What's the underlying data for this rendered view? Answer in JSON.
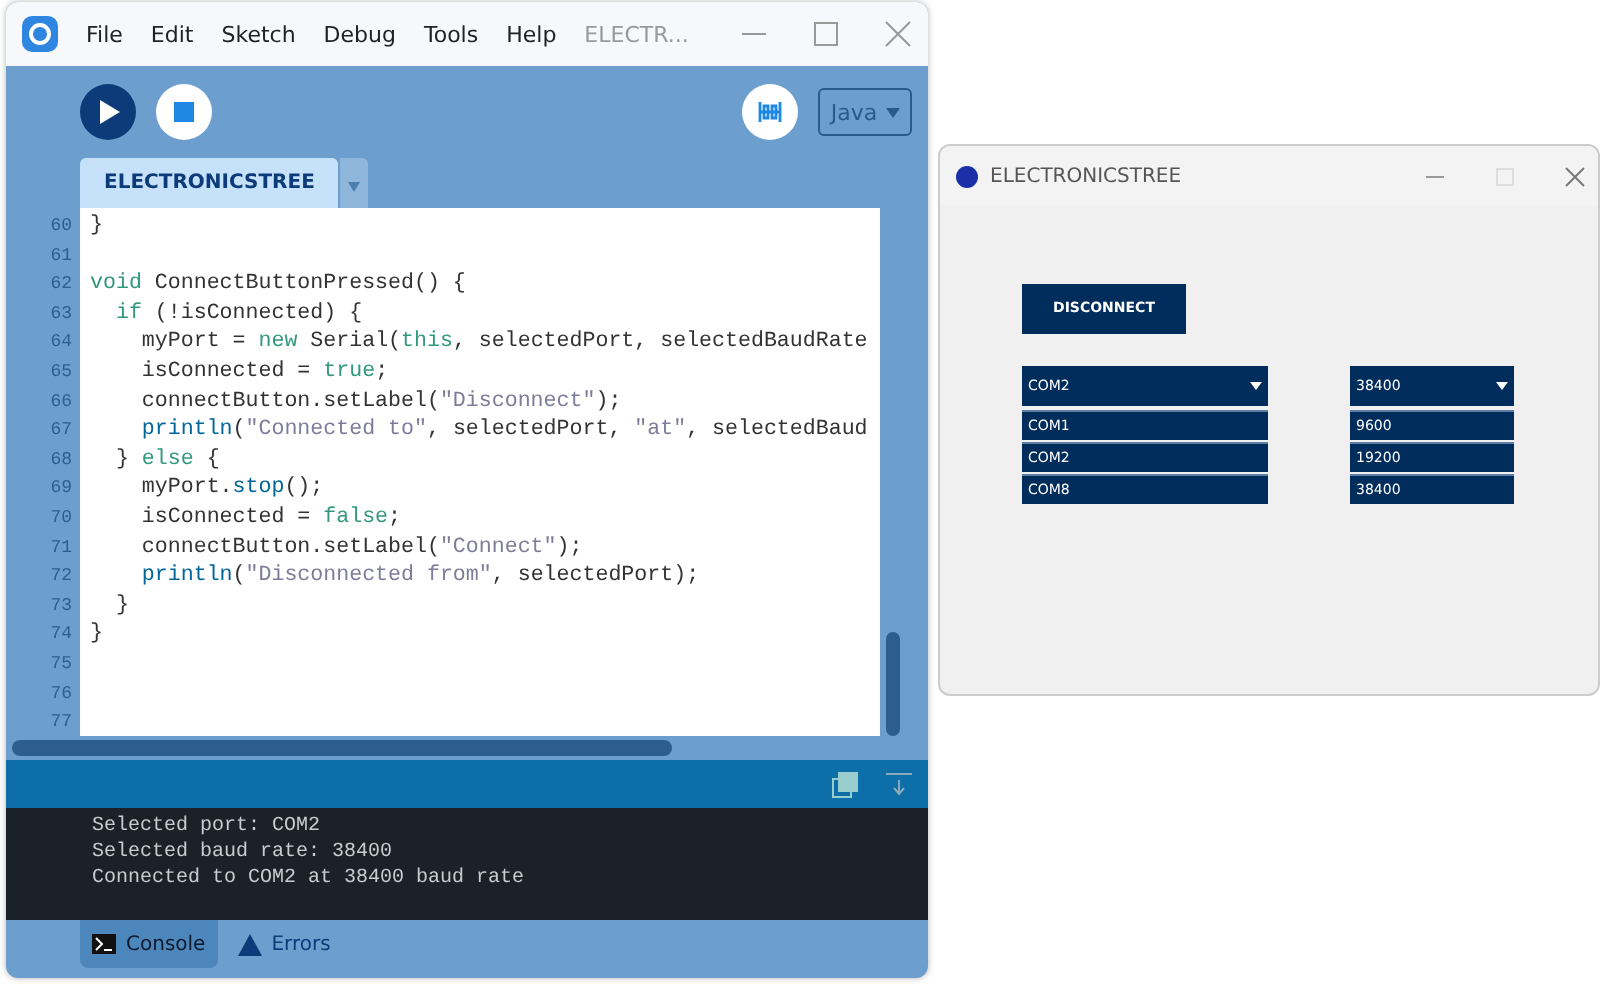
{
  "ide": {
    "menu": [
      "File",
      "Edit",
      "Sketch",
      "Debug",
      "Tools",
      "Help"
    ],
    "title": "ELECTR...",
    "mode": "Java",
    "tabs": [
      {
        "label": "ELECTRONICSTREE",
        "selected": true
      }
    ],
    "code": [
      {
        "number": "60",
        "segments": [
          {
            "kind": "plain",
            "text": "}"
          }
        ]
      },
      {
        "number": "61"
      },
      {
        "number": "62",
        "segments": [
          {
            "kind": "keyword",
            "text": "void"
          },
          {
            "kind": "plain",
            "text": " ConnectButtonPressed() {"
          }
        ]
      },
      {
        "number": "63",
        "segments": [
          {
            "kind": "keyword",
            "text": "  if"
          },
          {
            "kind": "plain",
            "text": " (!isConnected) {"
          }
        ]
      },
      {
        "number": "64",
        "segments": [
          {
            "kind": "plain",
            "text": "    myPort = "
          },
          {
            "kind": "keyword",
            "text": "new"
          },
          {
            "kind": "plain",
            "text": " Serial("
          },
          {
            "kind": "keyword",
            "text": "this"
          },
          {
            "kind": "plain",
            "text": ", selectedPort, selectedBaudRate"
          }
        ]
      },
      {
        "number": "65",
        "segments": [
          {
            "kind": "plain",
            "text": "    isConnected = "
          },
          {
            "kind": "keyword",
            "text": "true"
          },
          {
            "kind": "plain",
            "text": ";"
          }
        ]
      },
      {
        "number": "66",
        "segments": [
          {
            "kind": "plain",
            "text": "    connectButton.setLabel("
          },
          {
            "kind": "string",
            "text": "\"Disconnect\""
          },
          {
            "kind": "plain",
            "text": ");"
          }
        ]
      },
      {
        "number": "67",
        "segments": [
          {
            "kind": "function",
            "text": "    println"
          },
          {
            "kind": "plain",
            "text": "("
          },
          {
            "kind": "string",
            "text": "\"Connected to\""
          },
          {
            "kind": "plain",
            "text": ", selectedPort, "
          },
          {
            "kind": "string",
            "text": "\"at\""
          },
          {
            "kind": "plain",
            "text": ", selectedBaud"
          }
        ]
      },
      {
        "number": "68",
        "segments": [
          {
            "kind": "plain",
            "text": "  } "
          },
          {
            "kind": "keyword",
            "text": "else"
          },
          {
            "kind": "plain",
            "text": " {"
          }
        ]
      },
      {
        "number": "69",
        "segments": [
          {
            "kind": "plain",
            "text": "    myPort."
          },
          {
            "kind": "function",
            "text": "stop"
          },
          {
            "kind": "plain",
            "text": "();"
          }
        ]
      },
      {
        "number": "70",
        "segments": [
          {
            "kind": "plain",
            "text": "    isConnected = "
          },
          {
            "kind": "keyword",
            "text": "false"
          },
          {
            "kind": "plain",
            "text": ";"
          }
        ]
      },
      {
        "number": "71",
        "segments": [
          {
            "kind": "plain",
            "text": "    connectButton.setLabel("
          },
          {
            "kind": "string",
            "text": "\"Connect\""
          },
          {
            "kind": "plain",
            "text": ");"
          }
        ]
      },
      {
        "number": "72",
        "segments": [
          {
            "kind": "function",
            "text": "    println"
          },
          {
            "kind": "plain",
            "text": "("
          },
          {
            "kind": "string",
            "text": "\"Disconnected from\""
          },
          {
            "kind": "plain",
            "text": ", selectedPort);"
          }
        ]
      },
      {
        "number": "73",
        "segments": [
          {
            "kind": "plain",
            "text": "  }"
          }
        ]
      },
      {
        "number": "74",
        "segments": [
          {
            "kind": "plain",
            "text": "}"
          }
        ]
      },
      {
        "number": "75"
      },
      {
        "number": "76"
      },
      {
        "number": "77"
      }
    ],
    "console": [
      "Selected port: COM2",
      "Selected baud rate: 38400",
      "Connected to COM2 at 38400 baud rate"
    ],
    "bottom_tabs": [
      {
        "label": "Console",
        "selected": true
      },
      {
        "label": "Errors",
        "selected": false
      }
    ]
  },
  "app": {
    "title": "ELECTRONICSTREE",
    "button": "DISCONNECT",
    "port": {
      "value": "COM2",
      "options": [
        "COM1",
        "COM2",
        "COM8"
      ]
    },
    "baud": {
      "value": "38400",
      "options": [
        "9600",
        "19200",
        "38400"
      ]
    }
  }
}
